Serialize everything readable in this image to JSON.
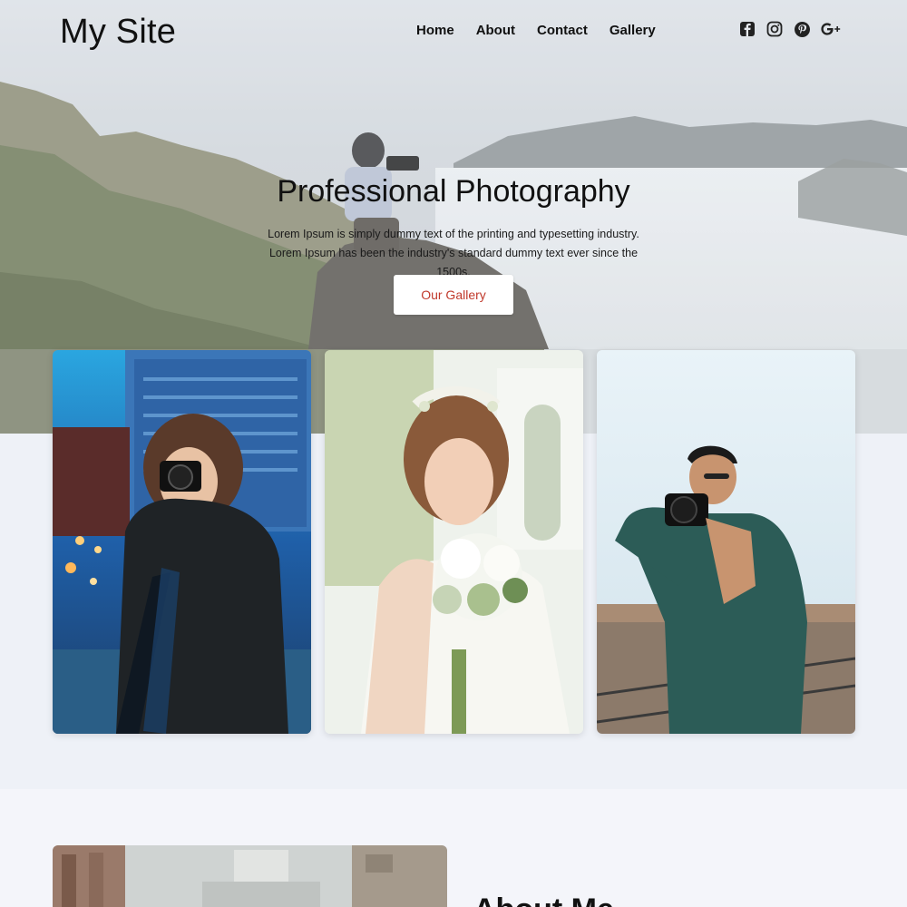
{
  "site": {
    "brand": "My Site"
  },
  "nav": {
    "items": [
      {
        "label": "Home"
      },
      {
        "label": "About"
      },
      {
        "label": "Contact"
      },
      {
        "label": "Gallery"
      }
    ]
  },
  "social": [
    "facebook-icon",
    "instagram-icon",
    "pinterest-icon",
    "google-plus-icon"
  ],
  "hero": {
    "title": "Professional Photography",
    "text": "Lorem Ipsum is simply dummy text of the printing and typesetting industry. Lorem Ipsum has been the industry's standard dummy text ever since the 1500s.",
    "cta_label": "Our Gallery"
  },
  "about": {
    "title": "About Me"
  },
  "colors": {
    "accent": "#c0392b",
    "page_bg": "#eef1f7",
    "text": "#111111"
  }
}
